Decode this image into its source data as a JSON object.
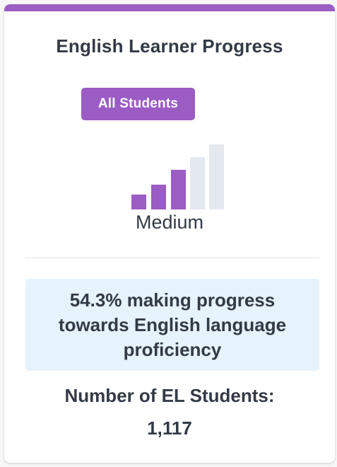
{
  "card": {
    "title": "English Learner Progress",
    "badge_label": "All Students",
    "level": {
      "label": "Medium",
      "filled_bars": 3,
      "total_bars": 5
    },
    "progress_text": "54.3% making progress towards English language proficiency",
    "count_label": "Number of EL Students:",
    "count_value": "1,117"
  },
  "colors": {
    "accent": "#9b5cc4",
    "bar_filled": "#9b5cc4",
    "bar_empty": "#e4e8ef",
    "progress_bg": "#e6f2fc",
    "text": "#333a45"
  }
}
